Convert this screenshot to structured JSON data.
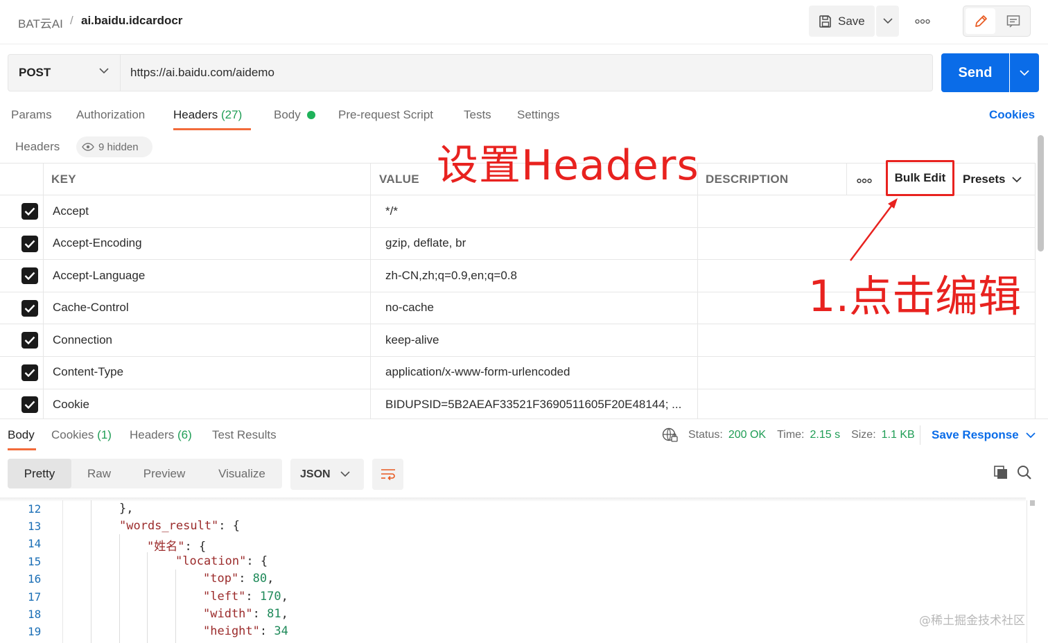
{
  "breadcrumb": {
    "workspace": "BAT云AI",
    "separator": "/",
    "request": "ai.baidu.idcardocr"
  },
  "toolbar": {
    "save_label": "Save"
  },
  "request": {
    "method": "POST",
    "url": "https://ai.baidu.com/aidemo",
    "send_label": "Send"
  },
  "tabs": {
    "params": "Params",
    "authorization": "Authorization",
    "headers": "Headers",
    "headers_count": "(27)",
    "body": "Body",
    "pre_request": "Pre-request Script",
    "tests": "Tests",
    "settings": "Settings",
    "cookies": "Cookies"
  },
  "headers_bar": {
    "label": "Headers",
    "hidden": "9 hidden"
  },
  "annotations": {
    "title": "设置Headers",
    "step": "1.点击编辑"
  },
  "table": {
    "columns": {
      "key": "KEY",
      "value": "VALUE",
      "description": "DESCRIPTION"
    },
    "bulk_edit": "Bulk Edit",
    "presets": "Presets",
    "rows": [
      {
        "key": "Accept",
        "value": "*/*"
      },
      {
        "key": "Accept-Encoding",
        "value": "gzip, deflate, br"
      },
      {
        "key": "Accept-Language",
        "value": "zh-CN,zh;q=0.9,en;q=0.8"
      },
      {
        "key": "Cache-Control",
        "value": "no-cache"
      },
      {
        "key": "Connection",
        "value": "keep-alive"
      },
      {
        "key": "Content-Type",
        "value": "application/x-www-form-urlencoded"
      },
      {
        "key": "Cookie",
        "value": "BIDUPSID=5B2AEAF33521F3690511605F20E48144; ..."
      }
    ]
  },
  "response": {
    "tabs": {
      "body": "Body",
      "cookies": "Cookies",
      "cookies_count": "(1)",
      "headers": "Headers",
      "headers_count": "(6)",
      "test_results": "Test Results"
    },
    "status_label": "Status:",
    "status_value": "200 OK",
    "time_label": "Time:",
    "time_value": "2.15 s",
    "size_label": "Size:",
    "size_value": "1.1 KB",
    "save_response": "Save Response",
    "views": [
      "Pretty",
      "Raw",
      "Preview",
      "Visualize"
    ],
    "format": "JSON"
  },
  "code": {
    "lines": [
      {
        "n": "12",
        "k": "",
        "v": "},"
      },
      {
        "n": "13",
        "k": "\"words_result\"",
        "v": ": {"
      },
      {
        "n": "14",
        "k": "\"姓名\"",
        "v": ": {"
      },
      {
        "n": "15",
        "k": "\"location\"",
        "v": ": {"
      },
      {
        "n": "16",
        "k": "\"top\"",
        "v": ": ",
        "num": "80",
        "tail": ","
      },
      {
        "n": "17",
        "k": "\"left\"",
        "v": ": ",
        "num": "170",
        "tail": ","
      },
      {
        "n": "18",
        "k": "\"width\"",
        "v": ": ",
        "num": "81",
        "tail": ","
      },
      {
        "n": "19",
        "k": "\"height\"",
        "v": ": ",
        "num": "34",
        "tail": ""
      }
    ]
  },
  "watermark": "@稀土掘金技术社区",
  "colors": {
    "accent": "#0a6ce8",
    "active_tab": "#f26b3a",
    "success": "#1f9d55",
    "annotation": "#e8221f"
  }
}
